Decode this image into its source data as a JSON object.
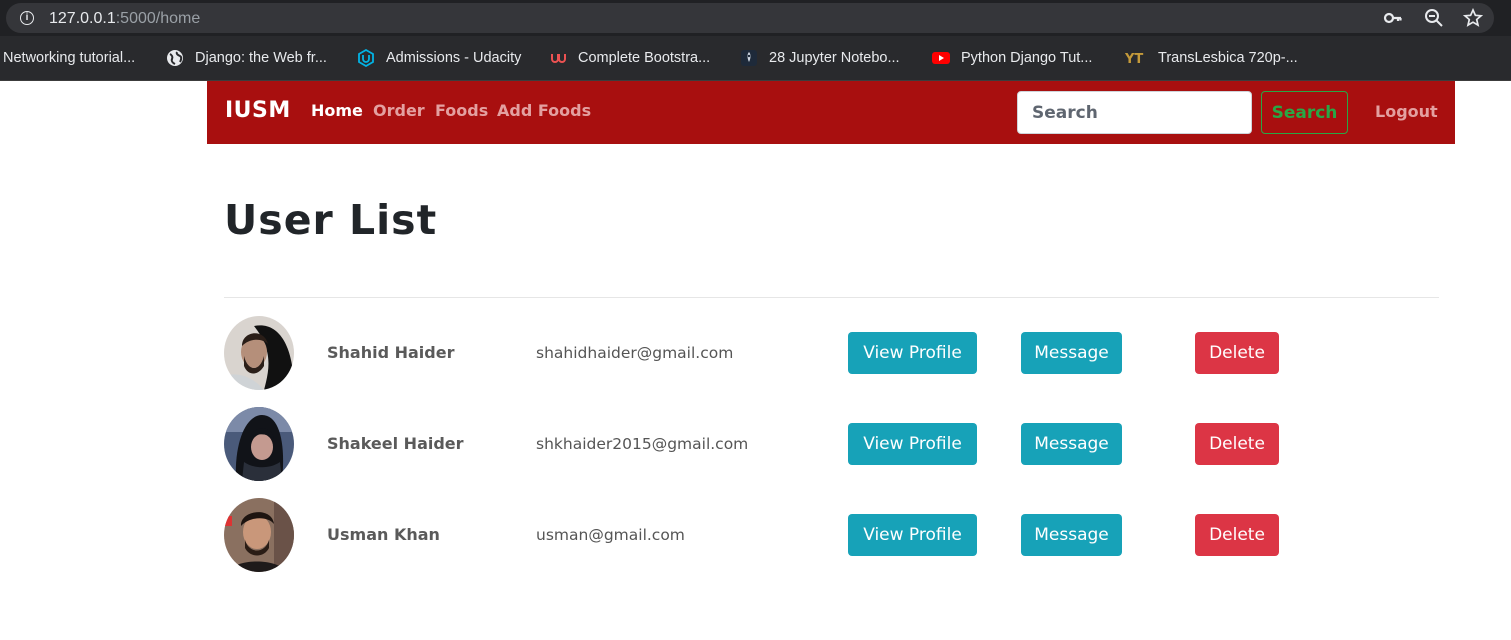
{
  "browser": {
    "url_host": "127.0.0.1",
    "url_rest": ":5000/home",
    "bookmarks": [
      {
        "label": "Networking tutorial...",
        "icon": "none"
      },
      {
        "label": "Django: the Web fr...",
        "icon": "globe-icon"
      },
      {
        "label": "Admissions - Udacity",
        "icon": "udacity-icon"
      },
      {
        "label": "Complete Bootstra...",
        "icon": "udemy-icon"
      },
      {
        "label": "28 Jupyter Notebo...",
        "icon": "rocket-icon"
      },
      {
        "label": "Python Django Tut...",
        "icon": "youtube-icon"
      },
      {
        "label": "TransLesbica 720p-...",
        "icon": "yt-text-icon"
      }
    ]
  },
  "navbar": {
    "brand": "IUSM",
    "links": [
      "Home",
      "Order",
      "Foods",
      "Add Foods"
    ],
    "search_placeholder": "Search",
    "search_button": "Search",
    "logout": "Logout",
    "bg_color": "#a80f0f"
  },
  "main": {
    "title": "User List",
    "users": [
      {
        "name": "Shahid Haider",
        "email": "shahidhaider@gmail.com"
      },
      {
        "name": "Shakeel Haider",
        "email": "shkhaider2015@gmail.com"
      },
      {
        "name": "Usman Khan",
        "email": "usman@gmail.com"
      }
    ],
    "actions": {
      "view": "View Profile",
      "message": "Message",
      "delete": "Delete"
    }
  }
}
